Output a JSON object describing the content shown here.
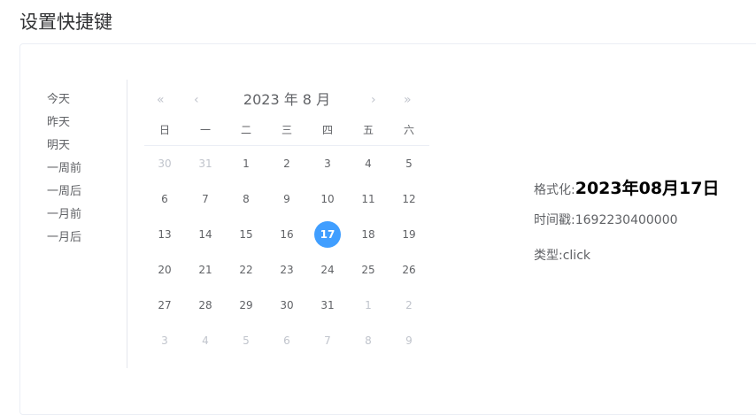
{
  "page_title": "设置快捷键",
  "shortcuts": [
    "今天",
    "昨天",
    "明天",
    "一周前",
    "一周后",
    "一月前",
    "一月后"
  ],
  "calendar": {
    "title": "2023 年 8 月",
    "icons": {
      "prev_year": "double-chevron-left-icon",
      "prev_month": "chevron-left-icon",
      "next_month": "chevron-right-icon",
      "next_year": "double-chevron-right-icon"
    },
    "weekdays": [
      "日",
      "一",
      "二",
      "三",
      "四",
      "五",
      "六"
    ],
    "days": [
      {
        "d": "30",
        "other": true
      },
      {
        "d": "31",
        "other": true
      },
      {
        "d": "1"
      },
      {
        "d": "2"
      },
      {
        "d": "3"
      },
      {
        "d": "4"
      },
      {
        "d": "5"
      },
      {
        "d": "6"
      },
      {
        "d": "7"
      },
      {
        "d": "8"
      },
      {
        "d": "9"
      },
      {
        "d": "10"
      },
      {
        "d": "11"
      },
      {
        "d": "12"
      },
      {
        "d": "13"
      },
      {
        "d": "14"
      },
      {
        "d": "15"
      },
      {
        "d": "16"
      },
      {
        "d": "17",
        "selected": true
      },
      {
        "d": "18"
      },
      {
        "d": "19"
      },
      {
        "d": "20"
      },
      {
        "d": "21"
      },
      {
        "d": "22"
      },
      {
        "d": "23"
      },
      {
        "d": "24"
      },
      {
        "d": "25"
      },
      {
        "d": "26"
      },
      {
        "d": "27"
      },
      {
        "d": "28"
      },
      {
        "d": "29"
      },
      {
        "d": "30"
      },
      {
        "d": "31"
      },
      {
        "d": "1",
        "other": true
      },
      {
        "d": "2",
        "other": true
      },
      {
        "d": "3",
        "other": true
      },
      {
        "d": "4",
        "other": true
      },
      {
        "d": "5",
        "other": true
      },
      {
        "d": "6",
        "other": true
      },
      {
        "d": "7",
        "other": true
      },
      {
        "d": "8",
        "other": true
      },
      {
        "d": "9",
        "other": true
      }
    ],
    "accent_color": "#409eff"
  },
  "info": {
    "format_label": "格式化:",
    "format_value": "2023年08月17日",
    "timestamp_label": "时间戳:",
    "timestamp_value": "1692230400000",
    "type_label": "类型:",
    "type_value": "click"
  }
}
